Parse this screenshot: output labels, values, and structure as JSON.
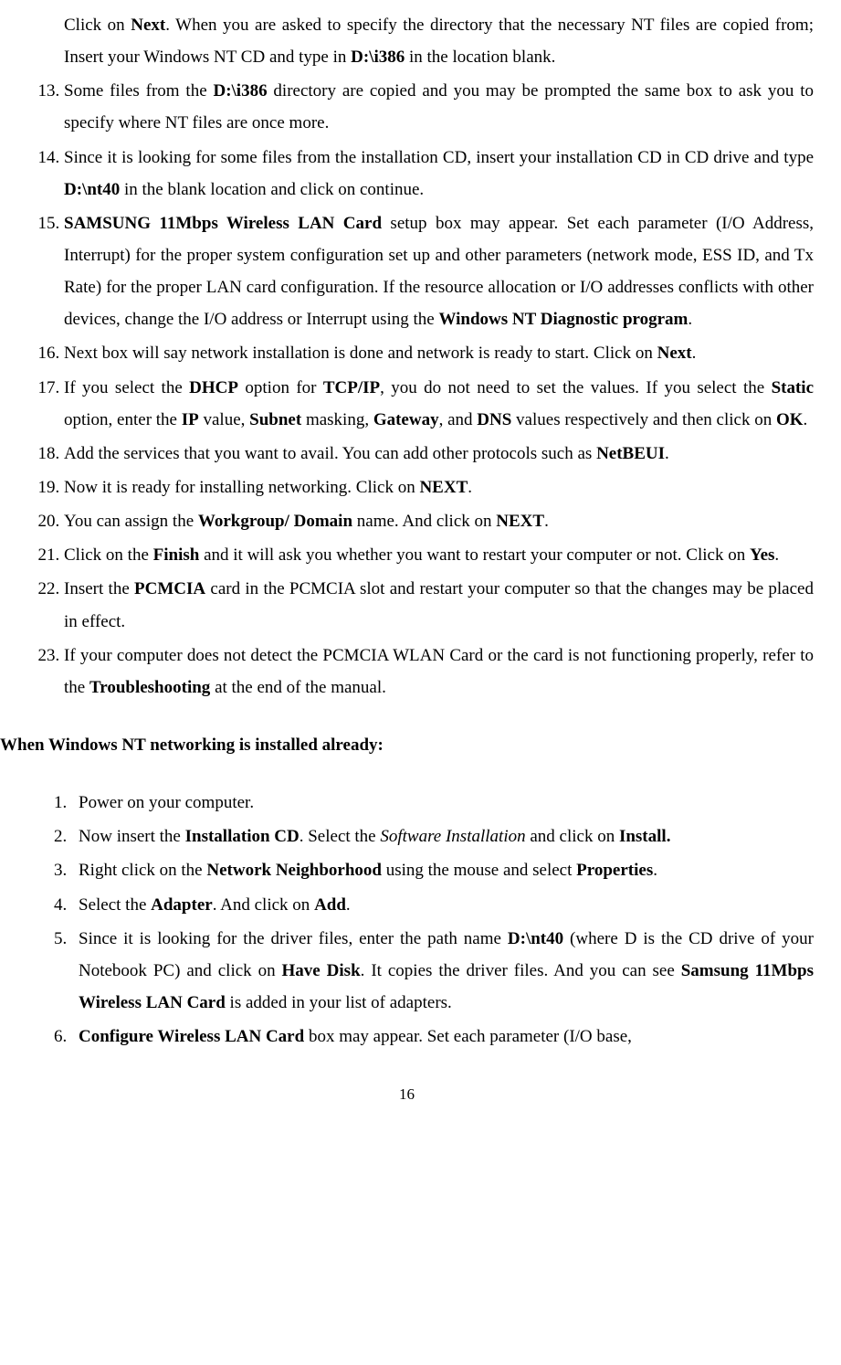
{
  "continuation12": {
    "pre1": "Click on ",
    "b1": "Next",
    "post1": ". When you are asked to specify the directory that the necessary NT files are copied from; Insert your Windows NT CD and type in ",
    "b2": "D:\\i386",
    "post2": " in the location blank."
  },
  "item13": {
    "pre": "Some files from the ",
    "b1": "D:\\i386",
    "post": " directory are copied and you may be prompted the same box to ask you to specify where NT files are once more."
  },
  "item14": {
    "pre": "Since it is looking for some files from the installation CD, insert your installation CD in CD drive and type ",
    "b1": "D:\\nt40",
    "post": " in the blank location and click on continue."
  },
  "item15": {
    "b1": "SAMSUNG 11Mbps Wireless LAN Card",
    "mid": " setup box may appear. Set each parameter (I/O Address, Interrupt) for the proper system configuration set up and other parameters (network mode, ESS ID, and Tx Rate) for the proper LAN card configuration. If the resource allocation or I/O addresses conflicts with other devices, change the I/O address or Interrupt using the ",
    "b2": "Windows NT Diagnostic program",
    "end": "."
  },
  "item16": {
    "pre": "Next box will say network installation is done and network is ready to start. Click on ",
    "b1": "Next",
    "end": "."
  },
  "item17": {
    "t1": "If you select the ",
    "b1": "DHCP",
    "t2": " option for ",
    "b2": "TCP/IP",
    "t3": ", you do not need to set the values. If you select the ",
    "b3": "Static",
    "t4": " option, enter the ",
    "b4": "IP",
    "t5": " value, ",
    "b5": "Subnet",
    "t6": " masking, ",
    "b6": "Gateway",
    "t7": ", and ",
    "b7": "DNS",
    "t8": " values respectively and then click on ",
    "b8": "OK",
    "t9": "."
  },
  "item18": {
    "pre": "Add the services that you want to avail. You can add other protocols such as ",
    "b1": "NetBEUI",
    "end": "."
  },
  "item19": {
    "pre": "Now it is ready for installing networking. Click on ",
    "b1": "NEXT",
    "end": "."
  },
  "item20": {
    "t1": "You can assign the ",
    "b1": "Workgroup/ Domain",
    "t2": " name. And click on ",
    "b2": "NEXT",
    "t3": "."
  },
  "item21": {
    "t1": "Click on the ",
    "b1": "Finish",
    "t2": " and it will ask you whether you want to restart your computer or not. Click on ",
    "b2": "Yes",
    "t3": "."
  },
  "item22": {
    "t1": "Insert the ",
    "b1": "PCMCIA",
    "t2": " card in the PCMCIA slot and restart your computer so that the changes may be placed in effect."
  },
  "item23": {
    "t1": "If your computer does not detect the PCMCIA WLAN Card or the card is not functioning properly, refer to the ",
    "b1": "Troubleshooting",
    "t2": " at the end of the manual."
  },
  "heading2": "When Windows NT networking is installed already:",
  "b_item1": "Power on your computer.",
  "b_item2": {
    "t1": "Now insert the ",
    "b1": "Installation CD",
    "t2": ". Select the ",
    "i1": "Software Installation",
    "t3": " and click on ",
    "b2": "Install.",
    "t4": ""
  },
  "b_item3": {
    "t1": "Right click on the ",
    "b1": "Network Neighborhood",
    "t2": " using the mouse and select ",
    "b2": "Properties",
    "t3": "."
  },
  "b_item4": {
    "t1": "Select the ",
    "b1": "Adapter",
    "t2": ". And click on ",
    "b2": "Add",
    "t3": "."
  },
  "b_item5": {
    "t1": "Since it is looking for the driver files, enter the path name ",
    "b1": "D:\\nt40",
    "t2": " (where D is the CD drive of your Notebook PC) and click on ",
    "b2": "Have Disk",
    "t3": ". It copies the driver files. And you can see ",
    "b3": "Samsung 11Mbps Wireless LAN Card",
    "t4": " is added in your list of adapters."
  },
  "b_item6": {
    "b1": "Configure Wireless LAN Card",
    "t1": " box may appear. Set each parameter (I/O base,"
  },
  "pageNumber": "16"
}
